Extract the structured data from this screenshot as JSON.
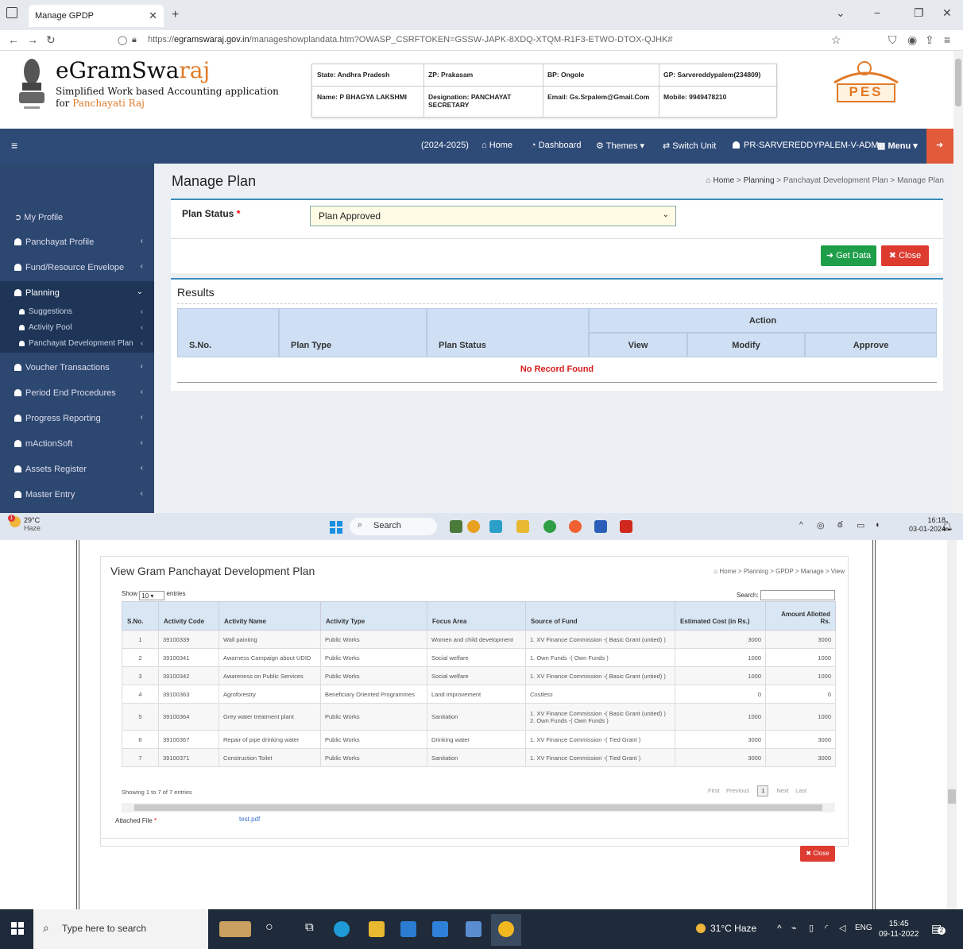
{
  "browser": {
    "tab_title": "Manage GPDP",
    "url_prefix": "https://",
    "url_domain": "egramswaraj.gov.in",
    "url_path": "/manageshowplandata.htm?OWASP_CSRFTOKEN=GSSW-JAPK-8XDQ-XTQM-R1F3-ETWO-DTOX-QJHK#"
  },
  "header": {
    "brand_main": "eGramSwa",
    "brand_accent": "raj",
    "sub_line1": "Simplified Work based Accounting application",
    "sub_line2_prefix": "for ",
    "sub_line2_accent": "Panchayati Raj",
    "info": {
      "state": "State: Andhra Pradesh",
      "zp": "ZP: Prakasam",
      "bp": "BP: Ongole",
      "gp": "GP: Sarvereddypalem(234809)",
      "name": "Name: P BHAGYA LAKSHMI",
      "designation": "Designation: PANCHAYAT SECRETARY",
      "email": "Email: Gs.Srpalem@Gmail.Com",
      "mobile": "Mobile: 9949478210"
    },
    "logo_text": "PES"
  },
  "navbar": {
    "year": "(2024-2025)",
    "home": "Home",
    "dashboard": "Dashboard",
    "themes": "Themes",
    "switch_unit": "Switch Unit",
    "user": "PR-SARVEREDDYPALEM-V-ADM",
    "menu": "Menu"
  },
  "sidebar": {
    "items": [
      {
        "label": "My Profile"
      },
      {
        "label": "Panchayat Profile"
      },
      {
        "label": "Fund/Resource Envelope"
      },
      {
        "label": "Planning"
      },
      {
        "label": "Voucher Transactions"
      },
      {
        "label": "Period End Procedures"
      },
      {
        "label": "Progress Reporting"
      },
      {
        "label": "mActionSoft"
      },
      {
        "label": "Assets Register"
      },
      {
        "label": "Master Entry"
      }
    ],
    "sub": [
      {
        "label": "Suggestions"
      },
      {
        "label": "Activity Pool"
      },
      {
        "label": "Panchayat Development Plan"
      }
    ]
  },
  "main": {
    "title": "Manage Plan",
    "breadcrumb": [
      "Home",
      "Planning",
      "Panchayat Development Plan",
      "Manage Plan"
    ],
    "plan_status_label": "Plan Status",
    "plan_status_value": "Plan Approved",
    "get_data": "Get Data",
    "close": "Close",
    "results_title": "Results",
    "cols": {
      "sno": "S.No.",
      "plan_type": "Plan Type",
      "plan_status": "Plan Status",
      "action": "Action",
      "view": "View",
      "modify": "Modify",
      "approve": "Approve"
    },
    "no_record": "No Record Found"
  },
  "taskbar1": {
    "temp": "29°C",
    "weather": "Haze",
    "badge": "1",
    "search": "Search",
    "time": "16:18",
    "date": "03-01-2024"
  },
  "view": {
    "title": "View Gram Panchayat Development Plan",
    "breadcrumb": [
      "Home",
      "Planning",
      "GPDP",
      "Manage",
      "View"
    ],
    "show_prefix": "Show",
    "show_value": "10",
    "show_suffix": "entries",
    "search_label": "Search:",
    "columns": [
      "S.No.",
      "Activity Code",
      "Activity Name",
      "Activity Type",
      "Focus Area",
      "Source of Fund",
      "Estimated Cost (in Rs.)",
      "Amount Allotted Rs."
    ],
    "rows": [
      {
        "sno": "1",
        "code": "39100339",
        "name": "Wall painting",
        "type": "Public Works",
        "focus": "Women and child development",
        "fund": "1. XV Finance Commission -( Basic Grant (untied) )",
        "fund2": "",
        "cost": "3000",
        "allotted": "3000"
      },
      {
        "sno": "2",
        "code": "39100341",
        "name": "Awarness Campaign about UDID",
        "type": "Public Works",
        "focus": "Social welfare",
        "fund": "1. Own Funds -( Own Funds )",
        "fund2": "",
        "cost": "1000",
        "allotted": "1000"
      },
      {
        "sno": "3",
        "code": "39100342",
        "name": "Awareness on Public Services",
        "type": "Public Works",
        "focus": "Social welfare",
        "fund": "1. XV Finance Commission -( Basic Grant (untied) )",
        "fund2": "",
        "cost": "1000",
        "allotted": "1000"
      },
      {
        "sno": "4",
        "code": "39100363",
        "name": "Agroforestry",
        "type": "Beneficiary Oriented Programmes",
        "focus": "Land improvement",
        "fund": "Costless",
        "fund2": "",
        "cost": "0",
        "allotted": "0"
      },
      {
        "sno": "5",
        "code": "39100364",
        "name": "Grey water treatment plant",
        "type": "Public Works",
        "focus": "Sanitation",
        "fund": "1. XV Finance Commission -( Basic Grant (untied) )",
        "fund2": "2. Own Funds -( Own Funds )",
        "cost": "1000",
        "allotted": "1000"
      },
      {
        "sno": "6",
        "code": "39100367",
        "name": "Repair of pipe drinking water",
        "type": "Public Works",
        "focus": "Drinking water",
        "fund": "1. XV Finance Commission -( Tied Grant )",
        "fund2": "",
        "cost": "3000",
        "allotted": "3000"
      },
      {
        "sno": "7",
        "code": "39100371",
        "name": "Construction Toilet",
        "type": "Public Works",
        "focus": "Sanitation",
        "fund": "1. XV Finance Commission -( Tied Grant )",
        "fund2": "",
        "cost": "3000",
        "allotted": "3000"
      }
    ],
    "showing": "Showing 1 to 7 of 7 entries",
    "pager": {
      "first": "First",
      "previous": "Previous",
      "current": "1",
      "next": "Next",
      "last": "Last"
    },
    "attached_label": "Attached File",
    "attached_file": "test.pdf",
    "close": "Close"
  },
  "taskbar2": {
    "search": "Type here to search",
    "weather": "31°C  Haze",
    "lang": "ENG",
    "time": "15:45",
    "date": "09-11-2022",
    "notif": "2"
  }
}
